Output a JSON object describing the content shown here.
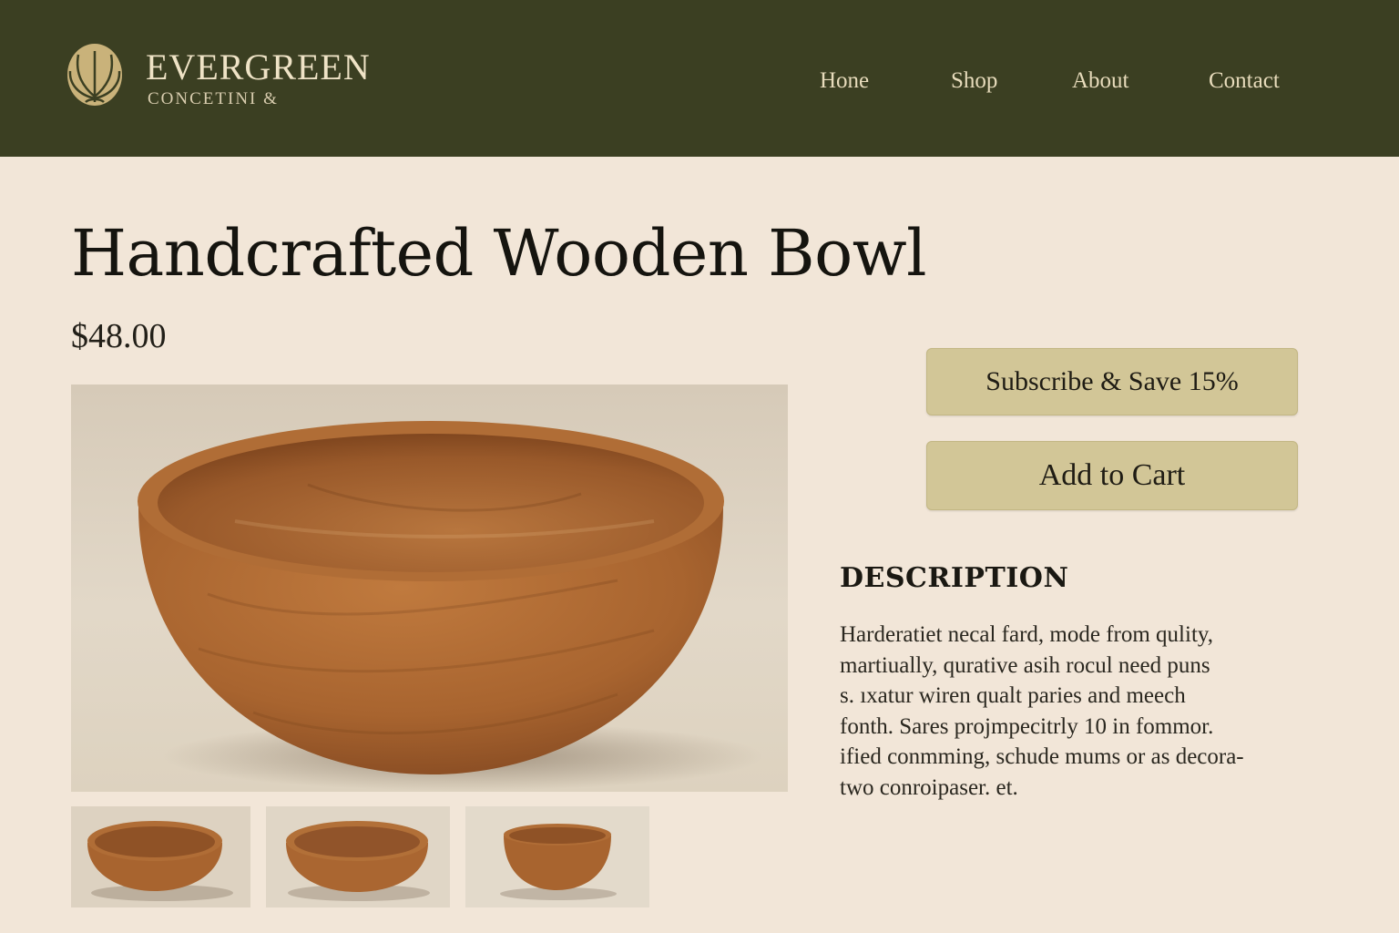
{
  "brand": {
    "name": "EVERGREEN",
    "subtitle": "CONCETINI &",
    "logo_icon": "leaf-shell-icon"
  },
  "nav": {
    "items": [
      {
        "label": "Hone"
      },
      {
        "label": "Shop"
      },
      {
        "label": "About"
      },
      {
        "label": "Contact"
      }
    ]
  },
  "product": {
    "title": "Handcrafted Wooden Bowl",
    "price": "$48.00"
  },
  "actions": {
    "subscribe_label": "Subscribe & Save 15%",
    "add_to_cart_label": "Add to Cart"
  },
  "description": {
    "heading": "DESCRIPTION",
    "lines": [
      "Harderatiet necal fard, mode from qulity,",
      "martiually, qurative asih rocul need puns",
      "s. ıxatur wiren qualt paries and meech",
      "fonth. Sares projmpecitrly 10 in fommor.",
      "ified conmming, schude mums or as decora-",
      "two conroipaser. et."
    ]
  },
  "colors": {
    "header_bg": "#3b3f22",
    "page_bg": "#f2e6d8",
    "button_bg": "#d2c697",
    "logo_gold": "#c9b27a",
    "wood": "#a86532"
  }
}
